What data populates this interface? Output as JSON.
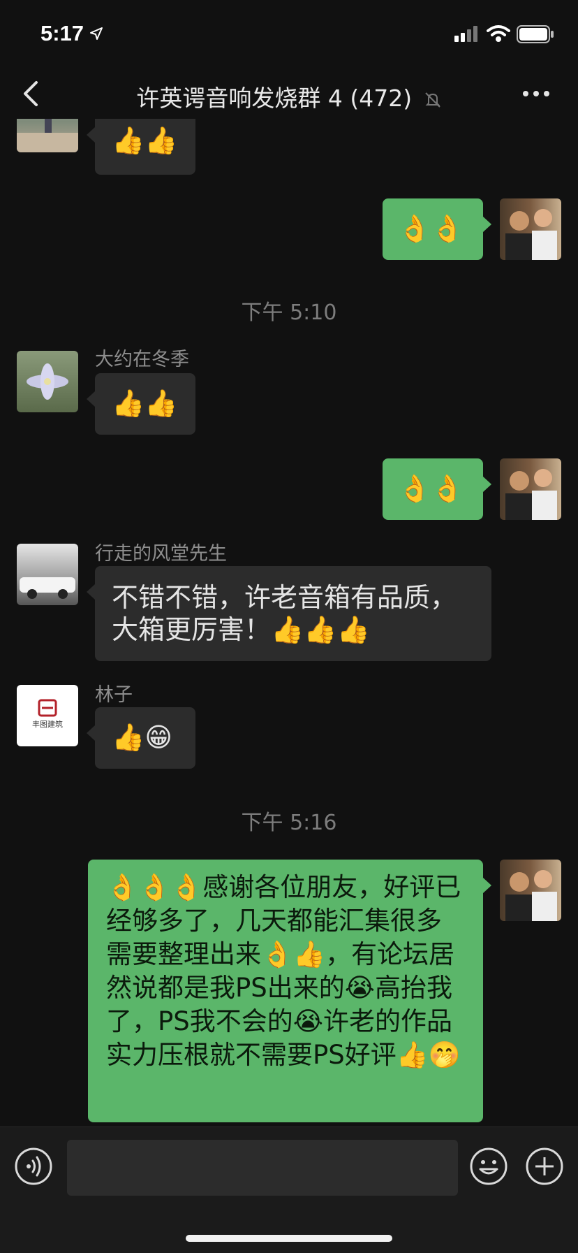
{
  "status": {
    "time": "5:17"
  },
  "header": {
    "back_label": "<",
    "title": "许英谔音响发烧群 4 (472)"
  },
  "messages": {
    "m1_text": "👍👍",
    "m2_text": "👌👌",
    "ts1": "下午 5:10",
    "m3_sender": "大约在冬季",
    "m3_text": "👍👍",
    "m4_text": "👌👌",
    "m5_sender": "行走的风堂先生",
    "m5_text": "不错不错，许老音箱有品质，大箱更厉害！👍👍👍",
    "m6_sender": "林子",
    "m6_text": "👍😁",
    "m6_avatar_logo": "丰图建筑",
    "ts2": "下午 5:16",
    "m7_text": "👌👌👌感谢各位朋友，好评已经够多了，几天都能汇集很多需要整理出来👌👍，有论坛居然说都是我PS出来的😭高抬我了，PS我不会的😭许老的作品实力压根就不需要PS好评👍🤭"
  },
  "input": {
    "placeholder": ""
  },
  "colors": {
    "out_bubble": "#5bb66a",
    "in_bubble": "#2c2c2c",
    "background": "#111111"
  }
}
